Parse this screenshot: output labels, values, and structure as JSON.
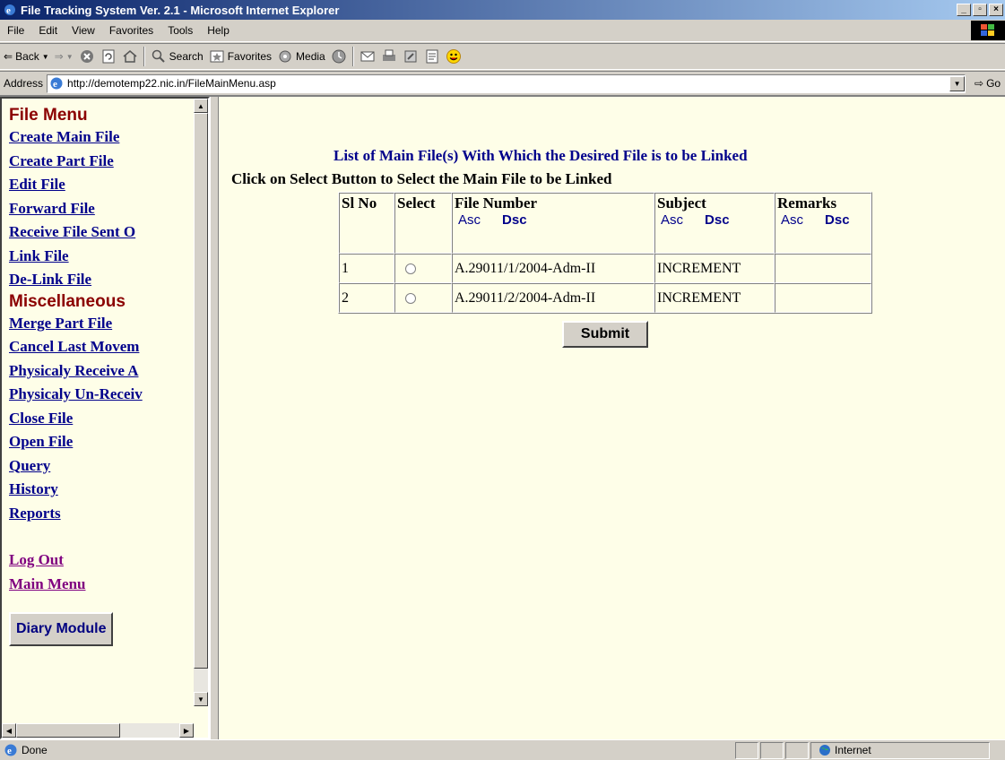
{
  "window": {
    "title": "File Tracking System Ver. 2.1 - Microsoft Internet Explorer"
  },
  "menubar": [
    "File",
    "Edit",
    "View",
    "Favorites",
    "Tools",
    "Help"
  ],
  "toolbar": {
    "back": "Back",
    "search": "Search",
    "favorites": "Favorites",
    "media": "Media"
  },
  "address": {
    "label": "Address",
    "url": "http://demotemp22.nic.in/FileMainMenu.asp",
    "go": "Go"
  },
  "sidebar": {
    "file_menu_heading": "File Menu",
    "file_links": [
      "Create Main File",
      "Create Part File",
      "Edit File",
      "Forward File",
      "Receive File Sent O",
      "Link File",
      "De-Link File"
    ],
    "misc_heading": "Miscellaneous",
    "misc_links": [
      "Merge Part File",
      "Cancel Last Movem",
      "Physicaly Receive A",
      "Physicaly Un-Receiv",
      "Close File",
      "Open File",
      "Query",
      "History",
      "Reports"
    ],
    "logout": "Log Out",
    "main_menu": "Main Menu",
    "diary_button": "Diary Module"
  },
  "main": {
    "heading": "List of Main File(s) With Which the Desired File is to be Linked",
    "instruction": "Click on Select Button to Select the Main File to be Linked",
    "columns": {
      "sl_no": "Sl No",
      "select": "Select",
      "file_number": "File Number",
      "subject": "Subject",
      "remarks": "Remarks",
      "asc": "Asc",
      "dsc": "Dsc"
    },
    "rows": [
      {
        "sl": "1",
        "file_number": "A.29011/1/2004-Adm-II",
        "subject": "INCREMENT",
        "remarks": ""
      },
      {
        "sl": "2",
        "file_number": "A.29011/2/2004-Adm-II",
        "subject": "INCREMENT",
        "remarks": ""
      }
    ],
    "submit": "Submit"
  },
  "status": {
    "text": "Done",
    "zone": "Internet"
  }
}
